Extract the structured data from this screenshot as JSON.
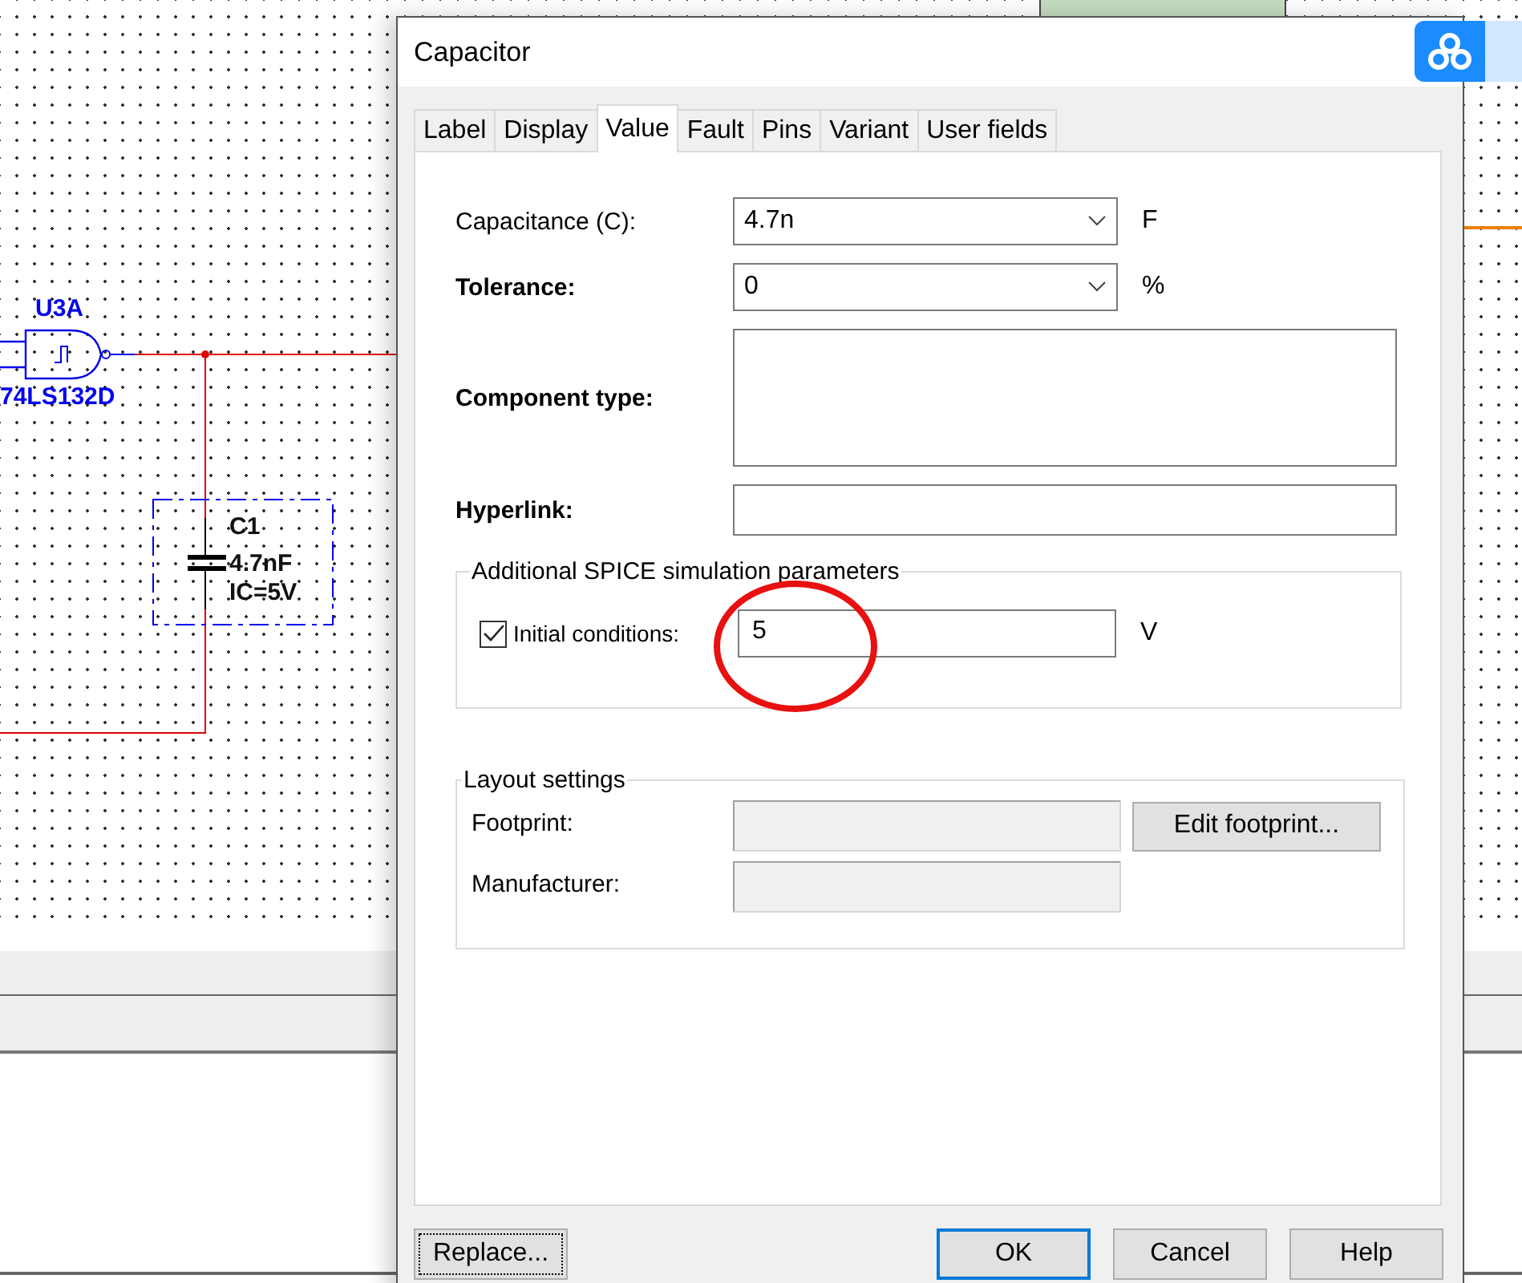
{
  "schematic": {
    "gate": {
      "ref": "U3A",
      "part": "74LS132D"
    },
    "capacitor": {
      "ref": "C1",
      "value": "4.7nF",
      "ic": "IC=5V"
    }
  },
  "dialog": {
    "title": "Capacitor",
    "tabs": [
      {
        "label": "Label",
        "selected": false
      },
      {
        "label": "Display",
        "selected": false
      },
      {
        "label": "Value",
        "selected": true
      },
      {
        "label": "Fault",
        "selected": false
      },
      {
        "label": "Pins",
        "selected": false
      },
      {
        "label": "Variant",
        "selected": false
      },
      {
        "label": "User fields",
        "selected": false
      }
    ],
    "fields": [
      {
        "kind": "combo",
        "label": "Capacitance (C):",
        "bold": false,
        "value": "4.7n",
        "unit": "F"
      },
      {
        "kind": "combo",
        "label": "Tolerance:",
        "bold": true,
        "value": "0",
        "unit": "%"
      },
      {
        "kind": "textarea",
        "label": "Component type:",
        "bold": true
      },
      {
        "kind": "text",
        "label": "Hyperlink:",
        "bold": true
      }
    ],
    "spice": {
      "title": "Additional SPICE simulation parameters",
      "checkbox": {
        "label": "Initial conditions:",
        "checked": true
      },
      "value": "5",
      "unit": "V"
    },
    "layout": {
      "title": "Layout settings",
      "fields": [
        {
          "label": "Footprint:",
          "disabled": true
        },
        {
          "label": "Manufacturer:",
          "disabled": true
        }
      ],
      "button": "Edit footprint..."
    },
    "buttons": [
      {
        "label": "Replace...",
        "kind": "focused"
      },
      {
        "label": "OK",
        "kind": "default"
      },
      {
        "label": "Cancel",
        "kind": "normal"
      },
      {
        "label": "Help",
        "kind": "normal"
      }
    ]
  }
}
